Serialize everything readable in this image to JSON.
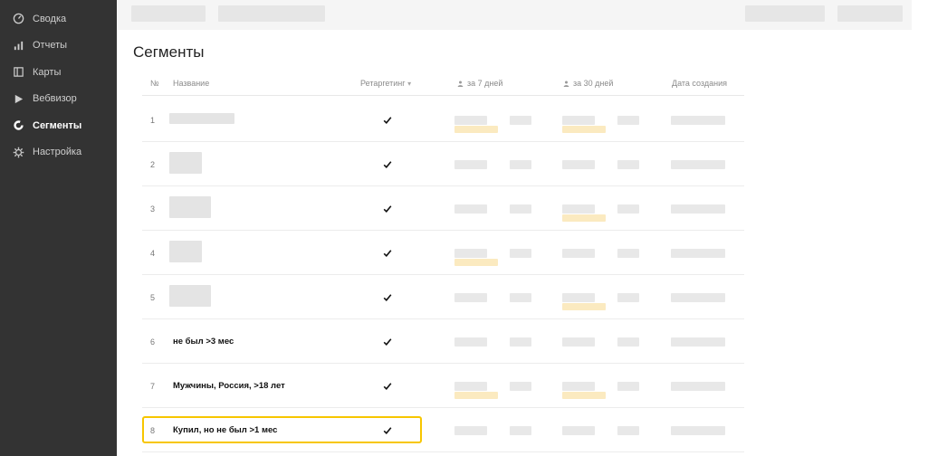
{
  "sidebar": {
    "items": [
      {
        "label": "Сводка",
        "icon": "dashboard-icon",
        "active": false
      },
      {
        "label": "Отчеты",
        "icon": "bar-chart-icon",
        "active": false
      },
      {
        "label": "Карты",
        "icon": "map-icon",
        "active": false
      },
      {
        "label": "Вебвизор",
        "icon": "play-icon",
        "active": false
      },
      {
        "label": "Сегменты",
        "icon": "segments-icon",
        "active": true
      },
      {
        "label": "Настройка",
        "icon": "gear-icon",
        "active": false
      }
    ]
  },
  "page": {
    "title": "Сегменты"
  },
  "table": {
    "headers": {
      "num": "№",
      "name": "Название",
      "retargeting": "Ретаргетинг",
      "days7": "за 7 дней",
      "days30": "за 30 дней",
      "created": "Дата создания"
    },
    "sort_indicator": "▾",
    "rows": [
      {
        "num": "1",
        "name": "",
        "retargeting": true
      },
      {
        "num": "2",
        "name": "",
        "retargeting": true
      },
      {
        "num": "3",
        "name": "",
        "retargeting": true
      },
      {
        "num": "4",
        "name": "",
        "retargeting": true
      },
      {
        "num": "5",
        "name": "",
        "retargeting": true
      },
      {
        "num": "6",
        "name": "не был >3 мес",
        "retargeting": true
      },
      {
        "num": "7",
        "name": "Мужчины, Россия, >18 лет",
        "retargeting": true
      },
      {
        "num": "8",
        "name": "Купил, но не был >1 мес",
        "retargeting": true
      }
    ]
  },
  "colors": {
    "sidebar_bg": "#333333",
    "highlight": "#f7c600",
    "blur_yellow": "#fbeac0"
  }
}
